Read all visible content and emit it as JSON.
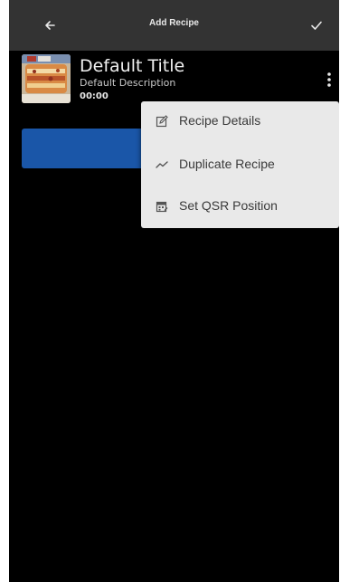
{
  "app_bar": {
    "title": "Add Recipe",
    "back_icon": "arrow-left-icon",
    "done_icon": "check-icon"
  },
  "recipe": {
    "title": "Default Title",
    "description": "Default Description",
    "time": "00:00",
    "thumbnail": "lasagna-photo"
  },
  "overflow_icon": "more-vertical-icon",
  "menu": {
    "items": [
      {
        "label": "Recipe Details",
        "icon": "edit-icon"
      },
      {
        "label": "Duplicate Recipe",
        "icon": "trend-icon"
      },
      {
        "label": "Set QSR Position",
        "icon": "calendar-edit-icon"
      }
    ]
  },
  "colors": {
    "app_bar": "#333333",
    "background": "#000000",
    "button": "#1a56a8",
    "menu": "#e9e9e9"
  }
}
